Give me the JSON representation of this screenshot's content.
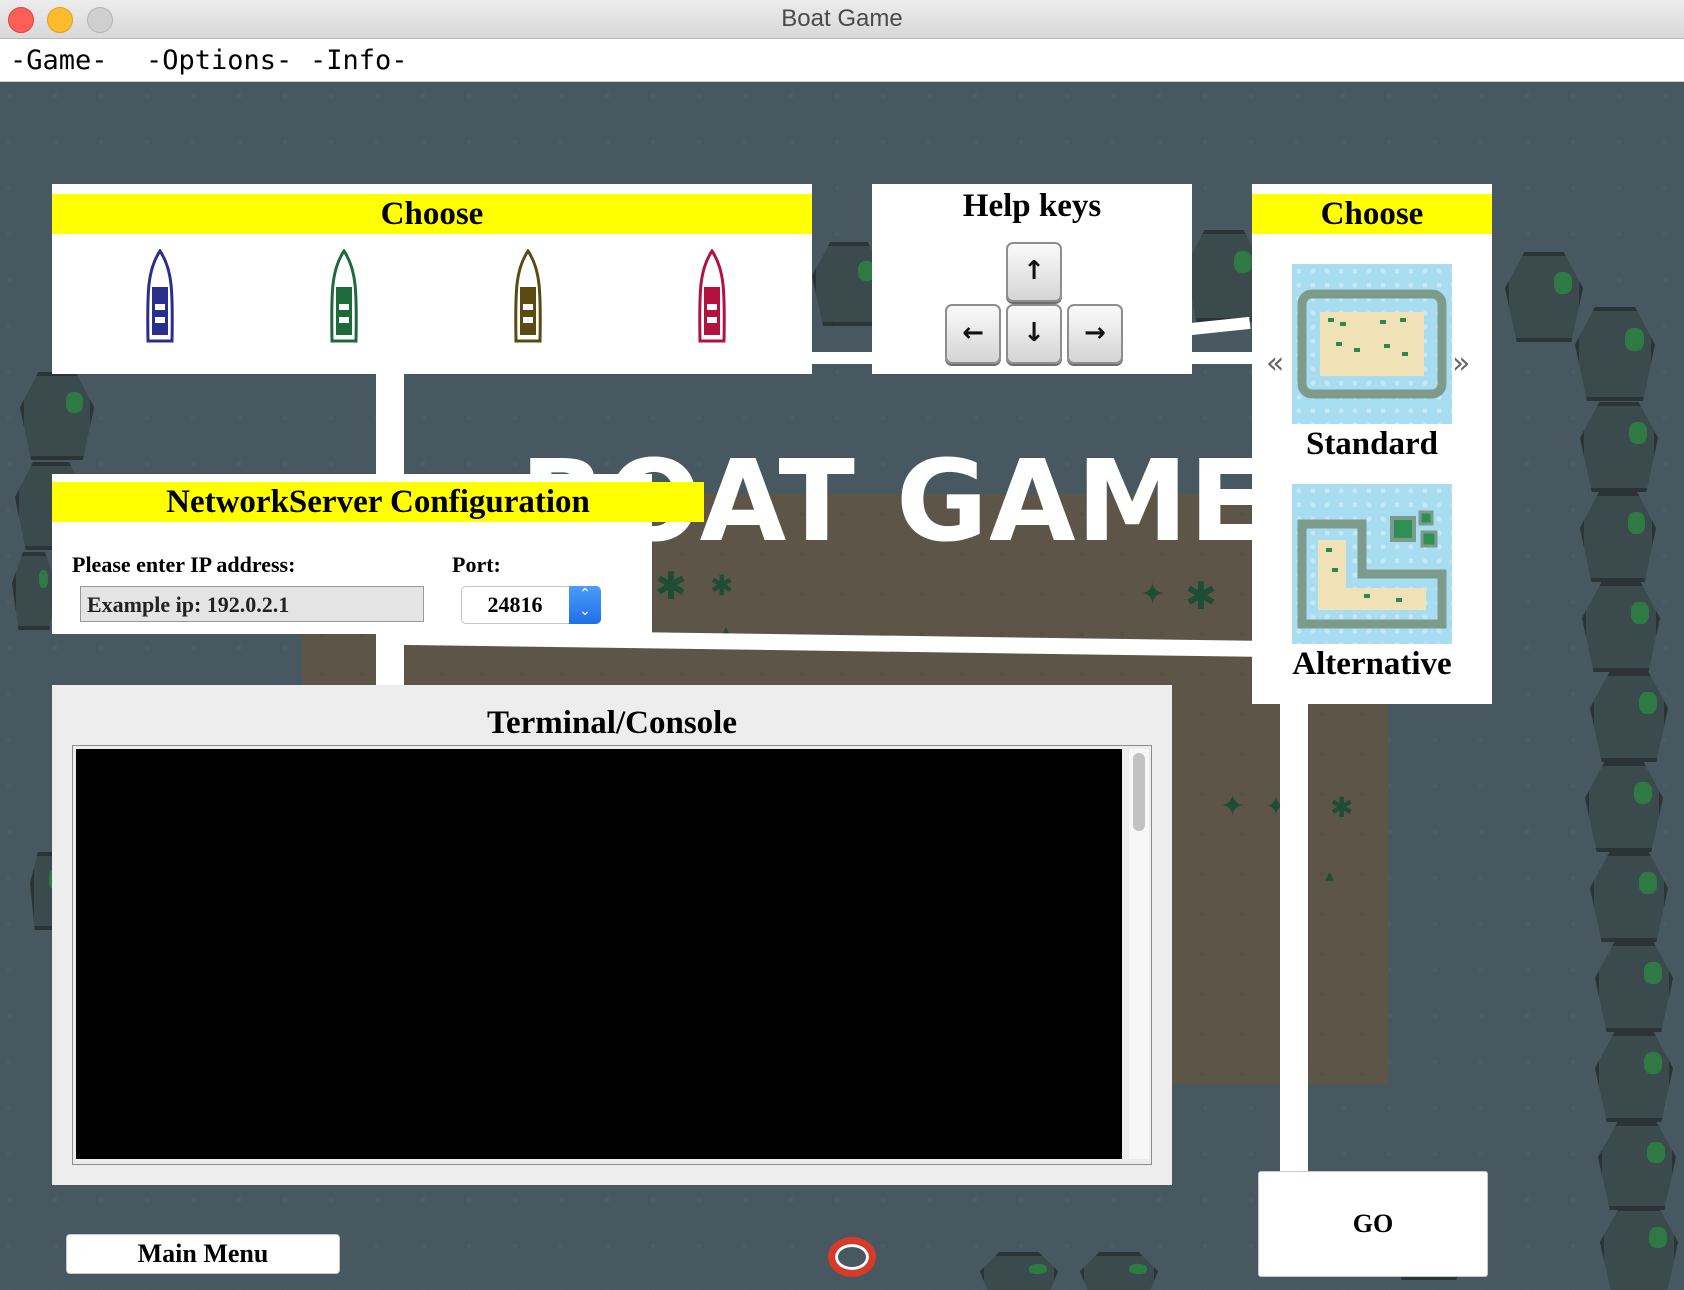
{
  "window": {
    "title": "Boat Game"
  },
  "menu": {
    "items": [
      "-Game-",
      "-Options-",
      "-Info-"
    ]
  },
  "background": {
    "title": "BOAT GAME"
  },
  "boat_picker": {
    "heading": "Choose",
    "boats": [
      {
        "name": "blue-boat",
        "color": "#2b2f8c"
      },
      {
        "name": "green-boat",
        "color": "#1d6b3a"
      },
      {
        "name": "olive-boat",
        "color": "#5b4a12"
      },
      {
        "name": "red-boat",
        "color": "#b3123f"
      }
    ]
  },
  "help_keys": {
    "heading": "Help keys",
    "keys": {
      "up": "↑",
      "left": "←",
      "down": "↓",
      "right": "→"
    }
  },
  "map_picker": {
    "heading": "Choose",
    "prev_symbol": "«",
    "next_symbol": "»",
    "maps": [
      {
        "label": "Standard"
      },
      {
        "label": "Alternative"
      }
    ]
  },
  "network": {
    "heading": "NetworkServer Configuration",
    "ip_label": "Please enter IP address:",
    "ip_value": "Example ip: 192.0.2.1",
    "port_label": "Port:",
    "port_value": "24816",
    "spinner_up": "⌃",
    "spinner_down": "⌄"
  },
  "console": {
    "heading": "Terminal/Console",
    "text": ""
  },
  "buttons": {
    "main_menu": "Main Menu",
    "go": "GO"
  },
  "colors": {
    "header_yellow": "#ffff00",
    "water": "#475860",
    "sand": "#5e5549",
    "spinner_blue": "#2f7df0"
  }
}
